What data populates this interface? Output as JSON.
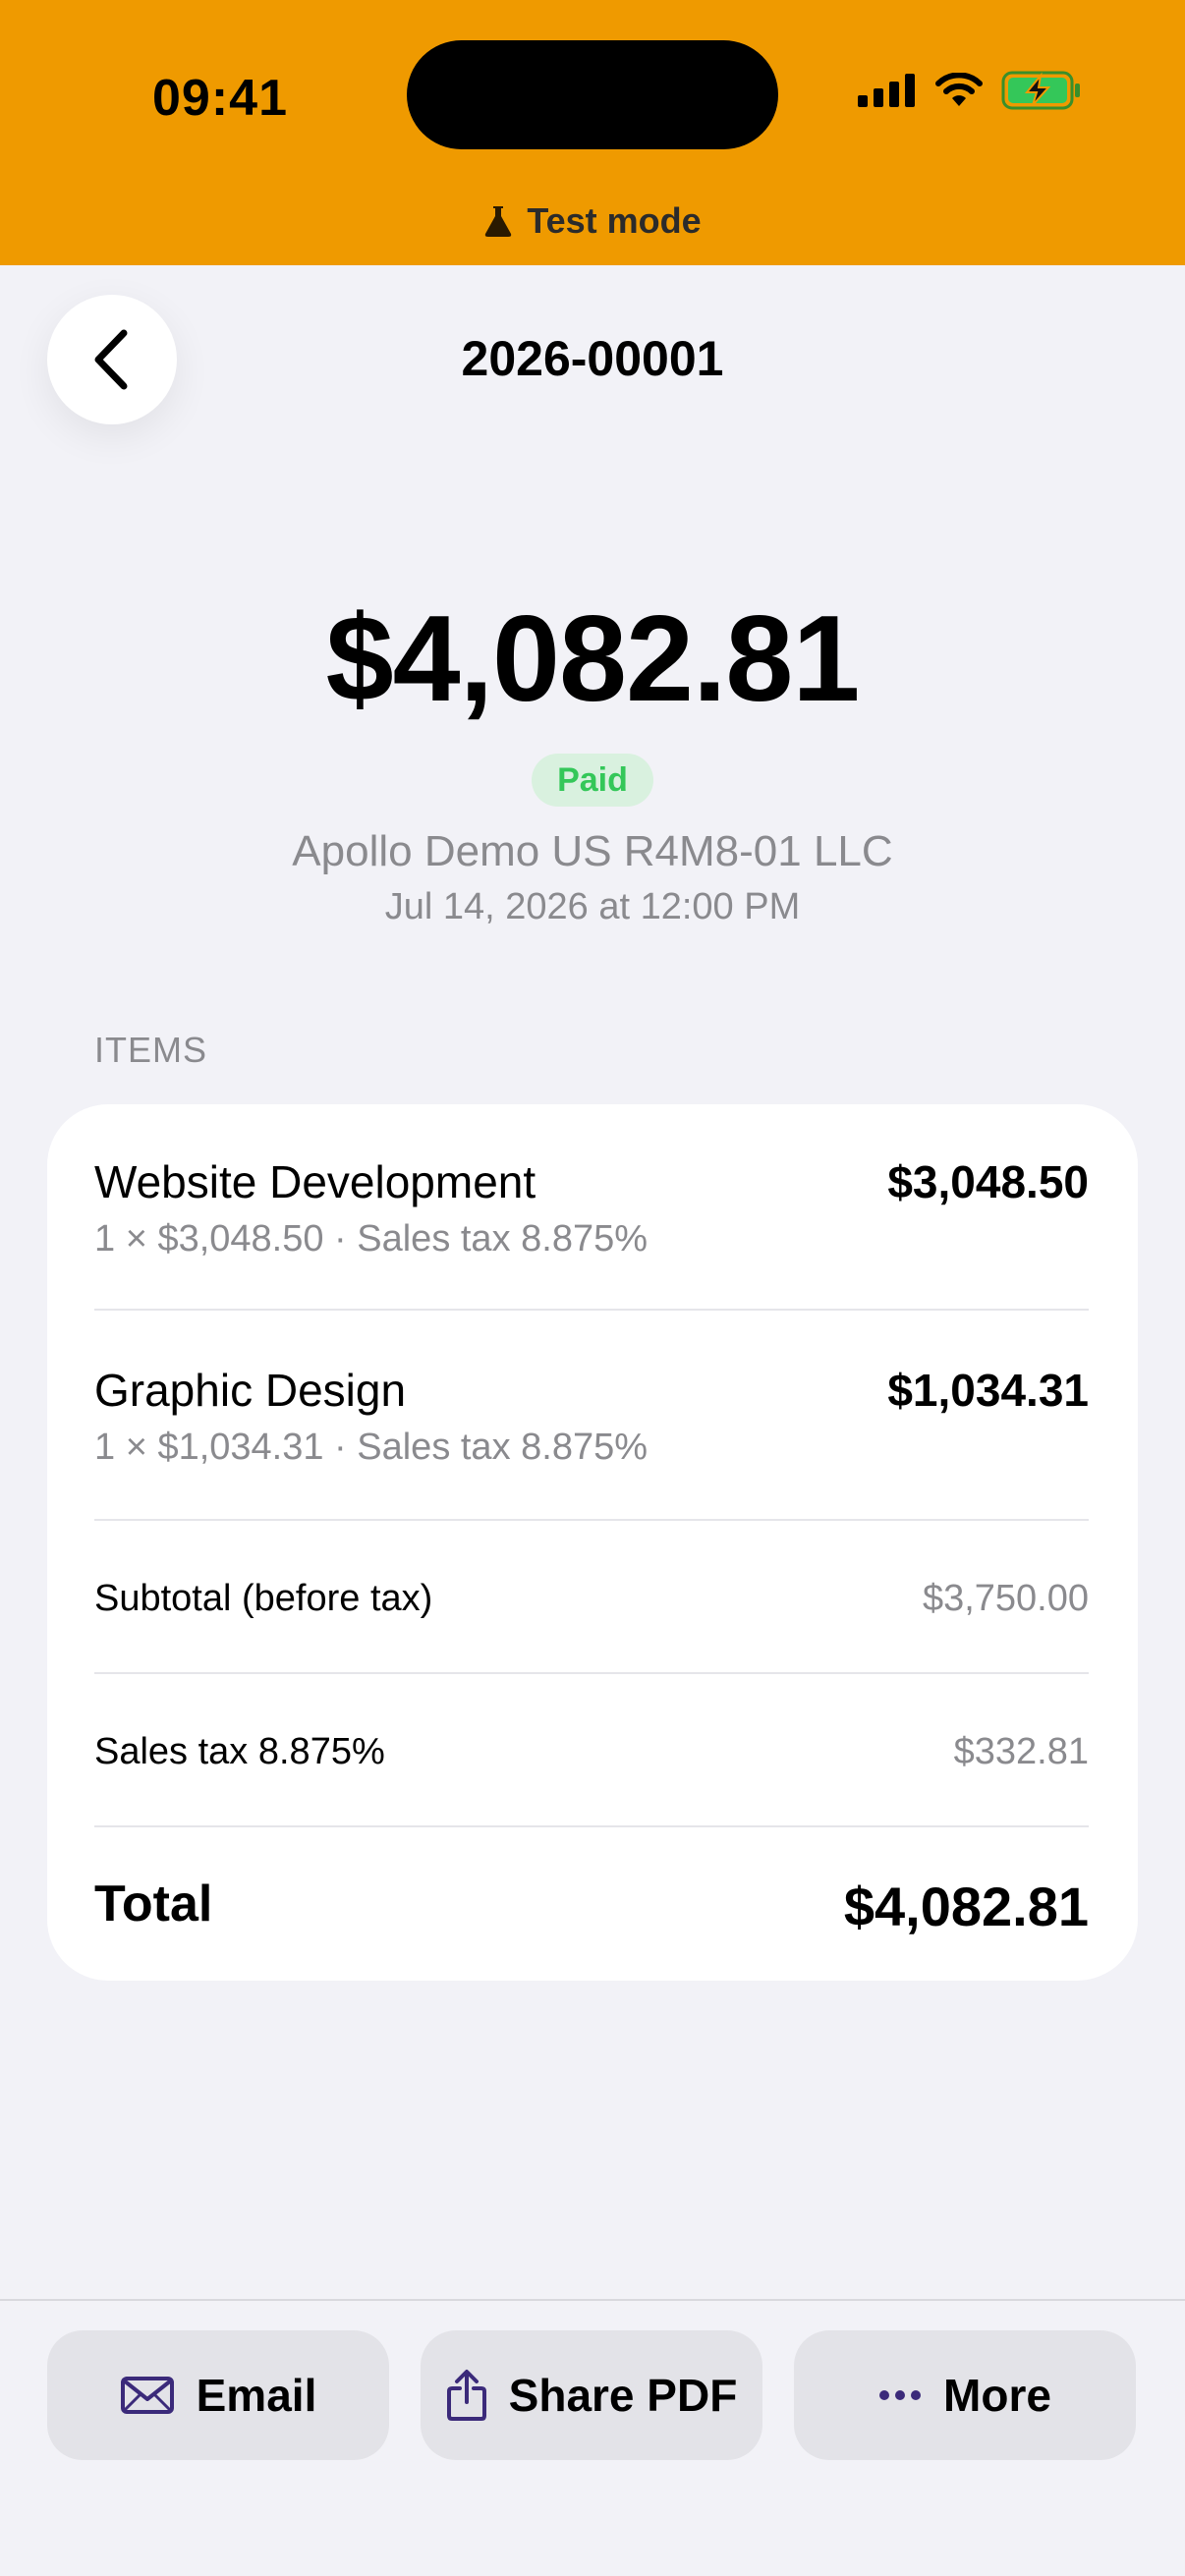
{
  "status_bar": {
    "time": "09:41"
  },
  "banner": {
    "label": "Test mode",
    "icon": "flask-icon"
  },
  "nav": {
    "title": "2026-00001",
    "back_icon": "chevron-left-icon"
  },
  "summary": {
    "amount": "$4,082.81",
    "status": "Paid",
    "company": "Apollo Demo US R4M8-01 LLC",
    "date": "Jul 14, 2026 at 12:00 PM"
  },
  "items_section": {
    "title": "ITEMS",
    "items": [
      {
        "name": "Website Development",
        "price": "$3,048.50",
        "detail": "1 × $3,048.50 · Sales tax 8.875%"
      },
      {
        "name": "Graphic Design",
        "price": "$1,034.31",
        "detail": "1 × $1,034.31 · Sales tax 8.875%"
      }
    ],
    "subtotal_label": "Subtotal (before tax)",
    "subtotal_value": "$3,750.00",
    "tax_label": "Sales tax 8.875%",
    "tax_value": "$332.81",
    "total_label": "Total",
    "total_value": "$4,082.81"
  },
  "actions": {
    "email": {
      "label": "Email",
      "icon": "envelope-icon"
    },
    "share": {
      "label": "Share PDF",
      "icon": "share-icon"
    },
    "more": {
      "label": "More",
      "icon": "ellipsis-icon"
    }
  },
  "colors": {
    "banner": "#ef9a00",
    "paid_text": "#34c759",
    "paid_bg": "#d9f1df",
    "accent_icon": "#3b2a7a",
    "background": "#f2f2f7"
  }
}
